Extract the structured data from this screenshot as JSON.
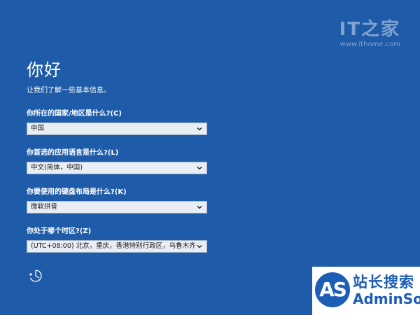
{
  "setup": {
    "title": "你好",
    "subtitle": "让我们了解一些基本信息。",
    "fields": [
      {
        "label": "你所在的国家/地区是什么?(C)",
        "value": "中国"
      },
      {
        "label": "你首选的应用语言是什么?(L)",
        "value": "中文(简体，中国)"
      },
      {
        "label": "你要使用的键盘布局是什么?(K)",
        "value": "微软拼音"
      },
      {
        "label": "你处于哪个时区?(Z)",
        "value": "(UTC+08:00) 北京，重庆，香港特别行政区，乌鲁木齐"
      }
    ],
    "accessibility_icon": "ease-of-access-icon"
  },
  "watermarks": {
    "ithome_logo": "IT之家",
    "ithome_url": "www.ithome.com",
    "admin_badge": "AS",
    "admin_cn": "站长搜索",
    "admin_en": "AdminSo"
  },
  "colors": {
    "background": "#1e5ba8",
    "select_bg": "#e9edf4",
    "watermark_blue": "#1c5db5"
  }
}
